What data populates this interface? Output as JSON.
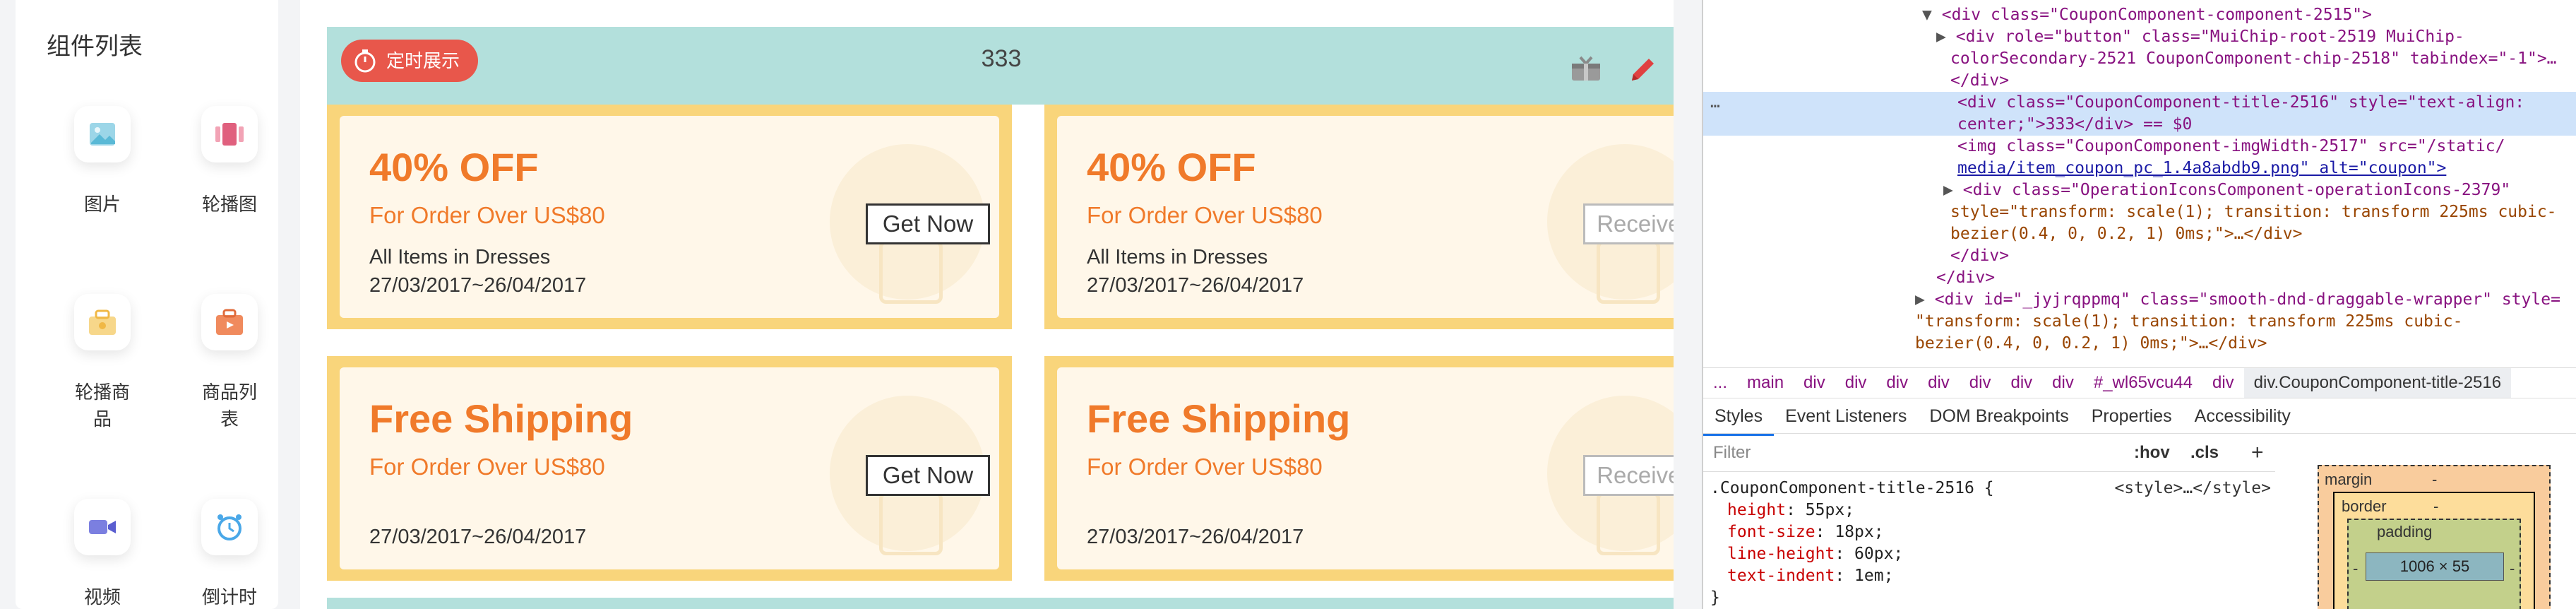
{
  "components": {
    "title": "组件列表",
    "items": [
      {
        "label": "图片",
        "icon": "image-icon"
      },
      {
        "label": "轮播图",
        "icon": "carousel-icon"
      },
      {
        "label": "轮播商品",
        "icon": "carousel-goods-icon"
      },
      {
        "label": "商品列表",
        "icon": "goods-list-icon"
      },
      {
        "label": "视频",
        "icon": "video-icon"
      },
      {
        "label": "倒计时",
        "icon": "countdown-icon"
      }
    ]
  },
  "canvas": {
    "chip_label": "定时展示",
    "coupon_title": "333",
    "coupons": [
      {
        "headline": "40% OFF",
        "sub": "For Order Over US$80",
        "items": "All Items in Dresses",
        "date": "27/03/2017~26/04/2017",
        "button": "Get Now"
      },
      {
        "headline": "40% OFF",
        "sub": "For Order Over US$80",
        "items": "All Items in Dresses",
        "date": "27/03/2017~26/04/2017",
        "button": "Received"
      },
      {
        "headline": "Free Shipping",
        "sub": "For Order Over US$80",
        "items": "",
        "date": "27/03/2017~26/04/2017",
        "button": "Get Now"
      },
      {
        "headline": "Free Shipping",
        "sub": "For Order Over US$80",
        "items": "",
        "date": "27/03/2017~26/04/2017",
        "button": "Received"
      }
    ],
    "colors": {
      "header_bg": "#b3e0dc",
      "chip": "#e8574b",
      "coupon_border": "#f9d57b",
      "accent": "#f07a2a"
    }
  },
  "devtools": {
    "dom": {
      "l1": "<div class=\"CouponComponent-component-2515\">",
      "l2a": "<div role=\"button\" class=\"MuiChip-root-2519 MuiChip-",
      "l2b": "colorSecondary-2521 CouponComponent-chip-2518\" tabindex=\"-1\">…",
      "l3": "</div>",
      "l4a": "<div class=\"CouponComponent-title-2516\" style=\"text-align:",
      "l4b": "center;\">333</div> == $0",
      "l5a": "<img class=\"CouponComponent-imgWidth-2517\" src=\"/static/",
      "l5b": "media/item_coupon_pc_1.4a8abdb9.png\" alt=\"coupon\">",
      "l6a": "<div class=\"OperationIconsComponent-operationIcons-2379\"",
      "l6b": "style=\"transform: scale(1); transition: transform 225ms cubic-",
      "l6c": "bezier(0.4, 0, 0.2, 1) 0ms;\">…</div>",
      "l7": "</div>",
      "l8": "</div>",
      "l9a": "<div id=\"_jyjrqppmq\" class=\"smooth-dnd-draggable-wrapper\" style=",
      "l9b": "\"transform: scale(1); transition: transform 225ms cubic-",
      "l9c": "bezier(0.4, 0, 0.2, 1) 0ms;\">…</div>"
    },
    "breadcrumbs": [
      "...",
      "main",
      "div",
      "div",
      "div",
      "div",
      "div",
      "div",
      "div",
      "#_wl65vcu44",
      "div",
      "div.CouponComponent-title-2516"
    ],
    "tabs": [
      "Styles",
      "Event Listeners",
      "DOM Breakpoints",
      "Properties",
      "Accessibility"
    ],
    "filter_placeholder": "Filter",
    "hov": ":hov",
    "cls": ".cls",
    "rule": {
      "selector": ".CouponComponent-title-2516 {",
      "source": "<style>…</style>",
      "decls": [
        {
          "prop": "height",
          "value": "55px;"
        },
        {
          "prop": "font-size",
          "value": "18px;"
        },
        {
          "prop": "line-height",
          "value": "60px;"
        },
        {
          "prop": "text-indent",
          "value": "1em;"
        }
      ],
      "close": "}"
    },
    "boxmodel": {
      "margin": "margin",
      "border": "border",
      "padding": "padding",
      "content": "1006 × 55",
      "dash": "-"
    }
  }
}
